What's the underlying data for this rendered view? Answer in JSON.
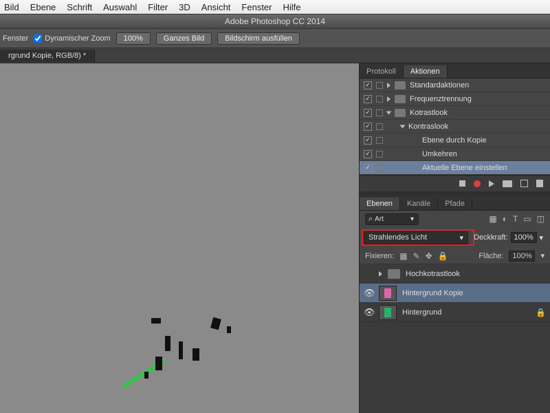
{
  "mac_menu": [
    "Bild",
    "Ebene",
    "Schrift",
    "Auswahl",
    "Filter",
    "3D",
    "Ansicht",
    "Fenster",
    "Hilfe"
  ],
  "app_title": "Adobe Photoshop CC 2014",
  "options_bar": {
    "fit_windows": "Fenster",
    "dyn_zoom": "Dynamischer Zoom",
    "zoom_value": "100%",
    "whole_image": "Ganzes Bild",
    "fill_screen": "Bildschirm ausfüllen"
  },
  "doc_tab": "rgrund Kopie, RGB/8) *",
  "actions_panel": {
    "tab_protokoll": "Protokoll",
    "tab_aktionen": "Aktionen",
    "rows": [
      {
        "label": "Standardaktionen",
        "indent": 0,
        "folder": true,
        "open": false,
        "check": true
      },
      {
        "label": "Frequenztrennung",
        "indent": 0,
        "folder": true,
        "open": false,
        "check": true
      },
      {
        "label": "Kotrastlook",
        "indent": 0,
        "folder": true,
        "open": true,
        "check": true
      },
      {
        "label": "Kontraslook",
        "indent": 1,
        "folder": false,
        "open": true,
        "check": true
      },
      {
        "label": "Ebene durch Kopie",
        "indent": 2,
        "folder": false,
        "open": false,
        "check": true
      },
      {
        "label": "Umkehren",
        "indent": 2,
        "folder": false,
        "open": false,
        "check": true
      },
      {
        "label": "Aktuelle Ebene einstellen",
        "indent": 2,
        "folder": false,
        "open": false,
        "check": true,
        "sel": true
      }
    ]
  },
  "layers_panel": {
    "tab_ebenen": "Ebenen",
    "tab_kanale": "Kanäle",
    "tab_pfade": "Pfade",
    "search_kind": "Art",
    "blend_mode": "Strahlendes Licht",
    "opacity_label": "Deckkraft:",
    "opacity_value": "100%",
    "lock_label": "Fixieren:",
    "fill_label": "Fläche:",
    "fill_value": "100%",
    "rows": [
      {
        "type": "group",
        "label": "Hochkotrastlook"
      },
      {
        "type": "layer",
        "label": "Hintergrund Kopie",
        "sel": true
      },
      {
        "type": "layer",
        "label": "Hintergrund",
        "locked": true
      }
    ]
  }
}
